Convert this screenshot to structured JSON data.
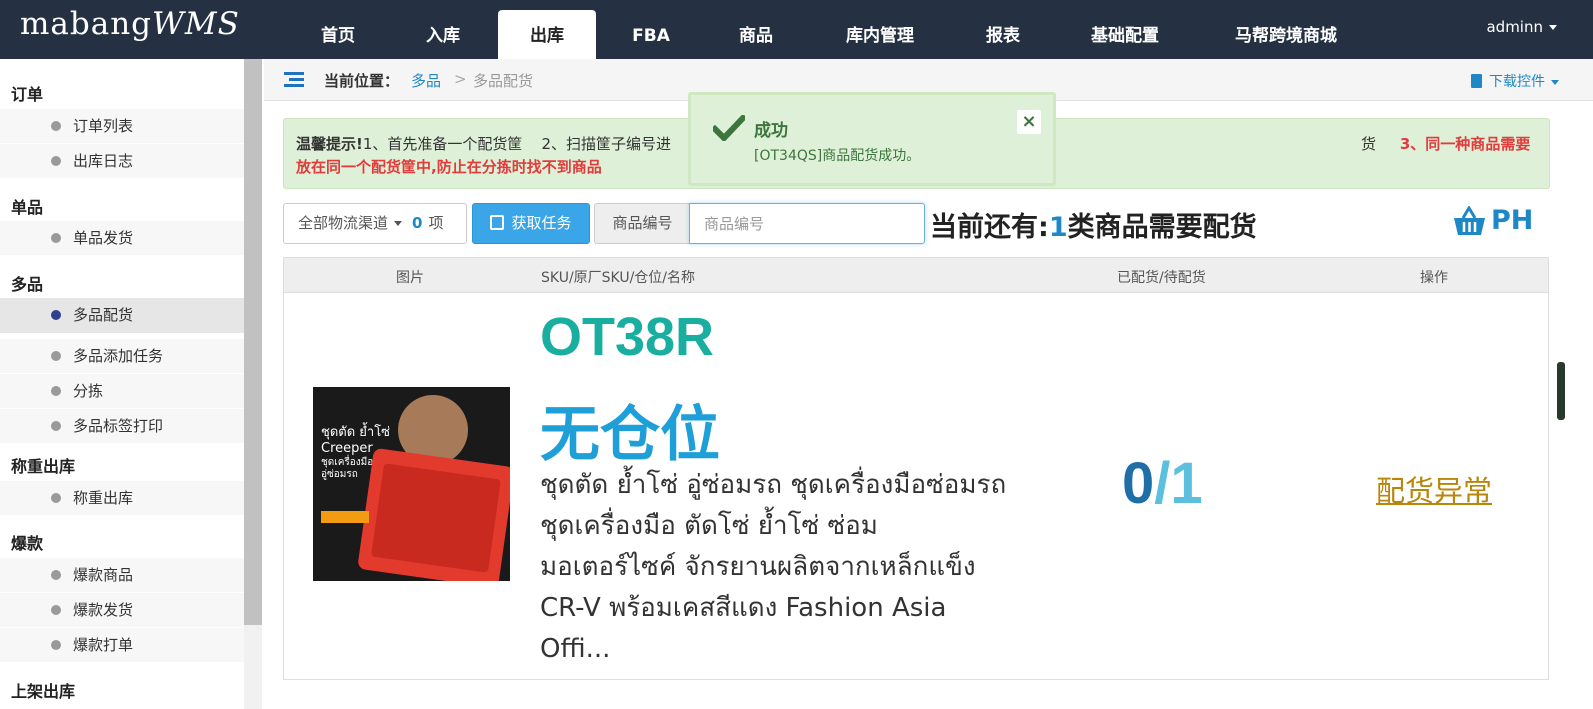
{
  "app": {
    "logo_main": "mabang",
    "logo_wms": "WMS",
    "user": "adminn"
  },
  "nav": {
    "items": [
      "首页",
      "入库",
      "出库",
      "FBA",
      "商品",
      "库内管理",
      "报表",
      "基础配置",
      "马帮跨境商城"
    ],
    "active": "出库"
  },
  "sidebar": {
    "groups": [
      {
        "title": "订单",
        "items": [
          "订单列表",
          "出库日志"
        ]
      },
      {
        "title": "单品",
        "items": [
          "单品发货"
        ]
      },
      {
        "title": "多品",
        "items": [
          "多品配货",
          "多品添加任务",
          "分拣",
          "多品标签打印"
        ]
      },
      {
        "title": "称重出库",
        "items": [
          "称重出库"
        ]
      },
      {
        "title": "爆款",
        "items": [
          "爆款商品",
          "爆款发货",
          "爆款打单"
        ]
      },
      {
        "title": "上架出库",
        "items": []
      }
    ],
    "active_item": "多品配货"
  },
  "breadcrumb": {
    "label": "当前位置：",
    "level1": "多品",
    "sep": ">",
    "level2": "多品配货",
    "download": "下载控件"
  },
  "tip": {
    "prefix": "温馨提示!",
    "step1": "1、首先准备一个配货筐",
    "step2": "2、扫描筐子编号进",
    "step2_tail": "货",
    "step3": "3、同一种商品需要放在同一个配货筐中,防止在分拣时找不到商品"
  },
  "toast": {
    "title": "成功",
    "message": "[OT34QS]商品配货成功。",
    "close": "×"
  },
  "toolbar": {
    "channel_label": "全部物流渠道",
    "channel_count": "0",
    "channel_unit": "项",
    "get_task": "获取任务",
    "sku_addon": "商品编号",
    "sku_placeholder": "商品编号",
    "sku_value": "",
    "remaining_prefix": "当前还有:",
    "remaining_count": "1",
    "remaining_suffix": "类商品需要配货",
    "basket_label": "PH"
  },
  "table": {
    "headers": [
      "图片",
      "SKU/原厂SKU/仓位/名称",
      "已配货/待配货",
      "操作"
    ],
    "row": {
      "image_text": [
        "ชุดตัด ย้ำโซ่",
        "Creeper",
        "ชุดเครื่องมือ",
        "อู่ซ่อมรถ"
      ],
      "sku": "OT38R",
      "location": "无仓位",
      "name": "ชุดตัด ย้ำโซ่ อู่ซ่อมรถ ชุดเครื่องมือซ่อมรถ ชุดเครื่องมือ ตัดโซ่ ย้ำโซ่ ซ่อมมอเตอร์ไซค์ จักรยานผลิตจากเหล็กแข็ง CR-V พร้อมเคสสีแดง Fashion Asia Offi...",
      "picked": "0",
      "sep": "/",
      "total": "1",
      "action": "配货异常"
    }
  },
  "colors": {
    "topbar": "#253142",
    "accent": "#1e88c7",
    "success_bg": "#dff0d8",
    "sku": "#1aaea0",
    "location": "#1e9fd8",
    "exception": "#b8860b"
  }
}
